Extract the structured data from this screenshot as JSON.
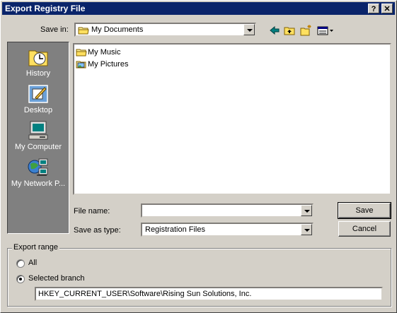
{
  "window": {
    "title": "Export Registry File",
    "help_label": "?",
    "close_label": "✕"
  },
  "save_in": {
    "label": "Save in:",
    "value": "My Documents"
  },
  "places": [
    {
      "label": "History",
      "icon": "history-icon"
    },
    {
      "label": "Desktop",
      "icon": "desktop-icon"
    },
    {
      "label": "My Computer",
      "icon": "my-computer-icon"
    },
    {
      "label": "My Network P...",
      "icon": "network-places-icon"
    }
  ],
  "files": [
    {
      "name": "My Music",
      "icon": "folder-icon"
    },
    {
      "name": "My Pictures",
      "icon": "pictures-folder-icon"
    }
  ],
  "file_name": {
    "label": "File name:",
    "value": ""
  },
  "save_as_type": {
    "label": "Save as type:",
    "value": "Registration Files"
  },
  "buttons": {
    "save": "Save",
    "cancel": "Cancel"
  },
  "export_range": {
    "legend": "Export range",
    "all_label": "All",
    "selected_label": "Selected branch",
    "selected": "branch",
    "branch_path": "HKEY_CURRENT_USER\\Software\\Rising Sun Solutions, Inc."
  },
  "colors": {
    "title_bar": "#0a246a",
    "face": "#d4d0c8",
    "places_bar": "#808080"
  }
}
